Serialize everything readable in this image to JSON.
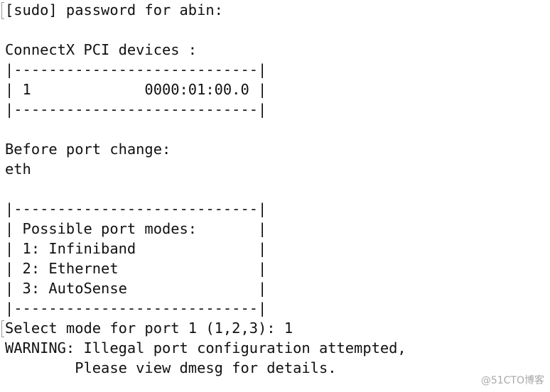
{
  "terminal": {
    "lines": [
      "[sudo] password for abin:",
      "",
      "ConnectX PCI devices :",
      "|----------------------------|",
      "| 1             0000:01:00.0 |",
      "|----------------------------|",
      "",
      "Before port change:",
      "eth",
      "",
      "|----------------------------|",
      "| Possible port modes:       |",
      "| 1: Infiniband              |",
      "| 2: Ethernet                |",
      "| 3: AutoSense               |",
      "|----------------------------|",
      "Select mode for port 1 (1,2,3): 1",
      "WARNING: Illegal port configuration attempted,",
      "        Please view dmesg for details."
    ]
  },
  "watermark": "@51CTO博客"
}
